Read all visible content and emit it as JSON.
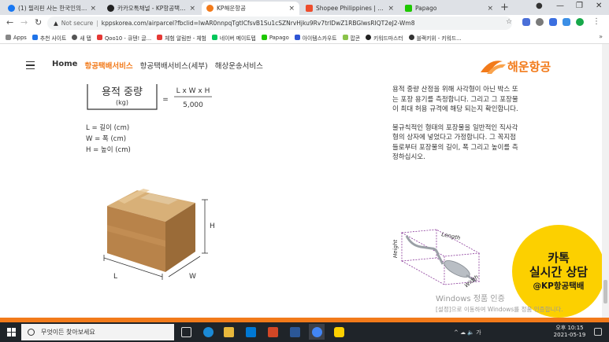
{
  "browser": {
    "tabs": [
      {
        "title": "(1) 필리핀 사는 한국인의 모...",
        "favicon_color": "#1877f2"
      },
      {
        "title": "카카오톡채널 - KP항공택배이...",
        "favicon_color": "#222222"
      },
      {
        "title": "KP해운항공",
        "favicon_color": "#f27a1a"
      },
      {
        "title": "Shopee Philippines | Buy an...",
        "favicon_color": "#ee4d2d"
      },
      {
        "title": "Papago",
        "favicon_color": "#1ec800"
      }
    ],
    "new_tab": "+",
    "address": {
      "security": "Not secure",
      "url": "kppskorea.com/airparcel?fbclid=IwAR0nnpqTgtlCfsvB1Su1cSZNrvHjku9Rv7trIDwZ1RBGlwsRIQT2eJ2-Wm8"
    },
    "bookmarks": [
      {
        "label": "Apps",
        "color": "#888888"
      },
      {
        "label": "추천 사이트",
        "color": "#1e73e8"
      },
      {
        "label": "새 탭",
        "color": "#555555"
      },
      {
        "label": "Qoo10 - 큐텐! 글...",
        "color": "#e53935"
      },
      {
        "label": "체험 알림판 - 체험",
        "color": "#e53935"
      },
      {
        "label": "네이버 메이트텝",
        "color": "#03c75a"
      },
      {
        "label": "Papago",
        "color": "#1ec800"
      },
      {
        "label": "아이템스카우트",
        "color": "#2f55d4"
      },
      {
        "label": "팝콘",
        "color": "#8bc34a"
      },
      {
        "label": "키워드마스터",
        "color": "#222222"
      },
      {
        "label": "블랙키위 - 키워드...",
        "color": "#333333"
      }
    ],
    "more": "»"
  },
  "site": {
    "menu": {
      "home": "Home",
      "item1": "항공택배서비스",
      "item2": "항공택배서비스(세부)",
      "item3": "해상운송서비스"
    },
    "logo_text": "해운항공",
    "formula": {
      "left_top": "용적 중량",
      "left_bottom": "(kg)",
      "equals": "=",
      "numerator": "L x W x H",
      "denominator": "5,000"
    },
    "legend": [
      "L  = 길이 (cm)",
      "W = 폭 (cm)",
      "H  = 높이 (cm)"
    ],
    "box_labels": {
      "l": "L",
      "w": "W",
      "h": "H"
    },
    "paragraph1": "용적 중량 산정을 위해 사각형이 아닌 박스 또는 포장 용기를 측정합니다. 그리고 그 포장물이 최대 허용 규격에 해당 되는지 확인합니다.",
    "paragraph2": "불규칙적인 형태의 포장물을 일반적인 직사각형의 상자에 넣었다고 가정합니다. 그 꼭지점들로부터 포장물의 길이, 폭 그리고 높이를 측정하십시오.",
    "pipe_labels": {
      "length": "Length",
      "height": "Height",
      "width": "Width"
    },
    "kakao": {
      "line1": "카톡",
      "line2": "실시간 상담",
      "line3": "@KP항공택배",
      "color": "#fcd000"
    },
    "watermark": {
      "line1": "Windows 정품 인증",
      "line2": "[설정]으로 이동하여 Windows를 정품 인증합니다."
    }
  },
  "taskbar": {
    "search_placeholder": "무엇이든 찾아보세요",
    "clock_time": "오후 10:15",
    "clock_date": "2021-05-19",
    "tray": "^ ☁ 🔈 가"
  },
  "colors": {
    "accent": "#f27a1a",
    "taskbar": "#1f2429"
  }
}
